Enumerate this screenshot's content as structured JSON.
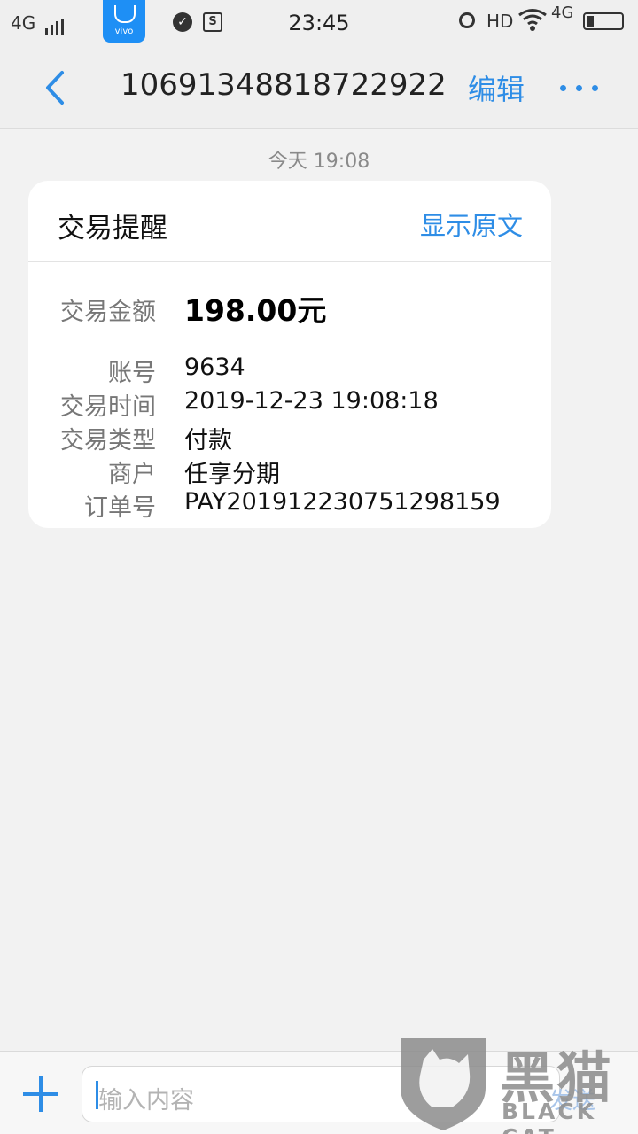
{
  "status_bar": {
    "network": "4G",
    "app_badge_text": "vivo",
    "time": "23:45",
    "hd": "HD",
    "network_right": "4G"
  },
  "nav": {
    "title": "1069134881872292​2…",
    "edit_label": "编辑"
  },
  "thread": {
    "timestamp": "今天 19:08"
  },
  "card": {
    "title": "交易提醒",
    "show_original": "显示原文",
    "rows": [
      {
        "label": "交易金额",
        "value": "198.00元"
      },
      {
        "label": "账号",
        "value": "9634"
      },
      {
        "label": "交易时间",
        "value": "2019-12-23 19:08:18"
      },
      {
        "label": "交易类型",
        "value": "付款"
      },
      {
        "label": "商户",
        "value": "任享分期"
      },
      {
        "label": "订单号",
        "value": "PAY2019122307512981​59"
      }
    ]
  },
  "composer": {
    "placeholder": "输入内容",
    "send_label": "发送"
  },
  "watermark": {
    "text_cn": "黑猫",
    "text_en": "BLACK CAT"
  },
  "colors": {
    "accent": "#2e8de6",
    "background": "#f2f2f2"
  }
}
